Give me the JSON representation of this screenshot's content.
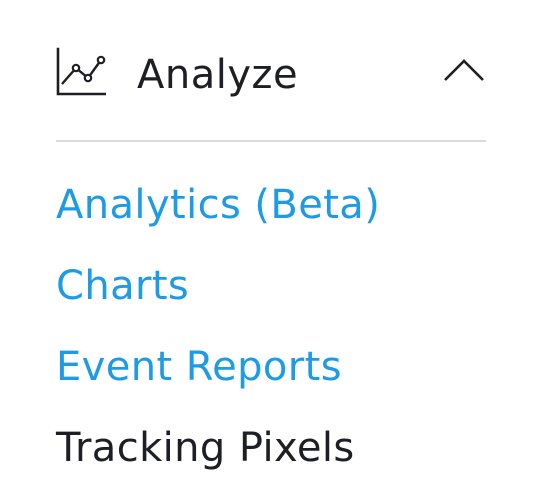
{
  "section": {
    "title": "Analyze",
    "icon": "line-chart-icon",
    "toggle_icon": "chevron-up-icon",
    "expanded": true
  },
  "menu": {
    "items": [
      {
        "label": "Analytics (Beta)",
        "color": "#1d9be7"
      },
      {
        "label": "Charts",
        "color": "#1d9be7"
      },
      {
        "label": "Event Reports",
        "color": "#1d9be7"
      },
      {
        "label": "Tracking Pixels",
        "color": "#1e1f24"
      }
    ]
  },
  "colors": {
    "link": "#1d9be7",
    "text": "#1e1f24",
    "divider": "#dbdbdb"
  }
}
